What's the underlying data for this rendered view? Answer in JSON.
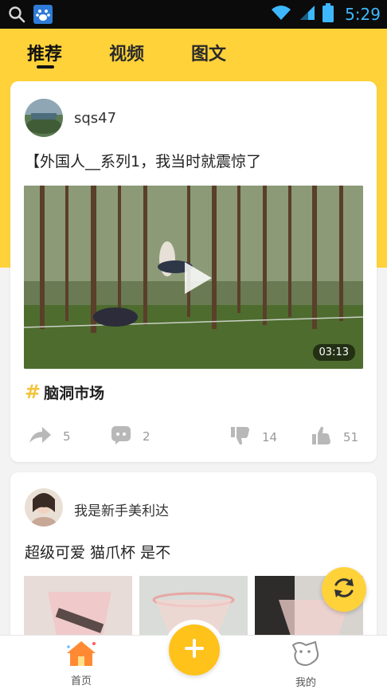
{
  "status_bar": {
    "time": "5:29",
    "icons": [
      "search-icon",
      "baidu-app-icon",
      "wifi-icon",
      "signal-icon",
      "battery-icon"
    ]
  },
  "top_tabs": [
    {
      "label": "推荐",
      "active": true
    },
    {
      "label": "视频",
      "active": false
    },
    {
      "label": "图文",
      "active": false
    }
  ],
  "posts": [
    {
      "username": "sqs47",
      "title": "【外国人__系列1，我当时就震惊了",
      "video_duration": "03:13",
      "topic_hash": "#",
      "topic": "脑洞市场",
      "shares": "5",
      "comments": "2",
      "dislikes": "14",
      "likes": "51"
    },
    {
      "username": "我是新手美利达",
      "title": "超级可爱 猫爪杯   是不"
    }
  ],
  "bottom_nav": {
    "home_label": "首页",
    "mine_label": "我的"
  },
  "colors": {
    "accent_yellow": "#ffd23a",
    "add_button": "#ffc21a",
    "status_bar": "#0b0b0b",
    "status_icon_blue": "#3db8ff"
  }
}
